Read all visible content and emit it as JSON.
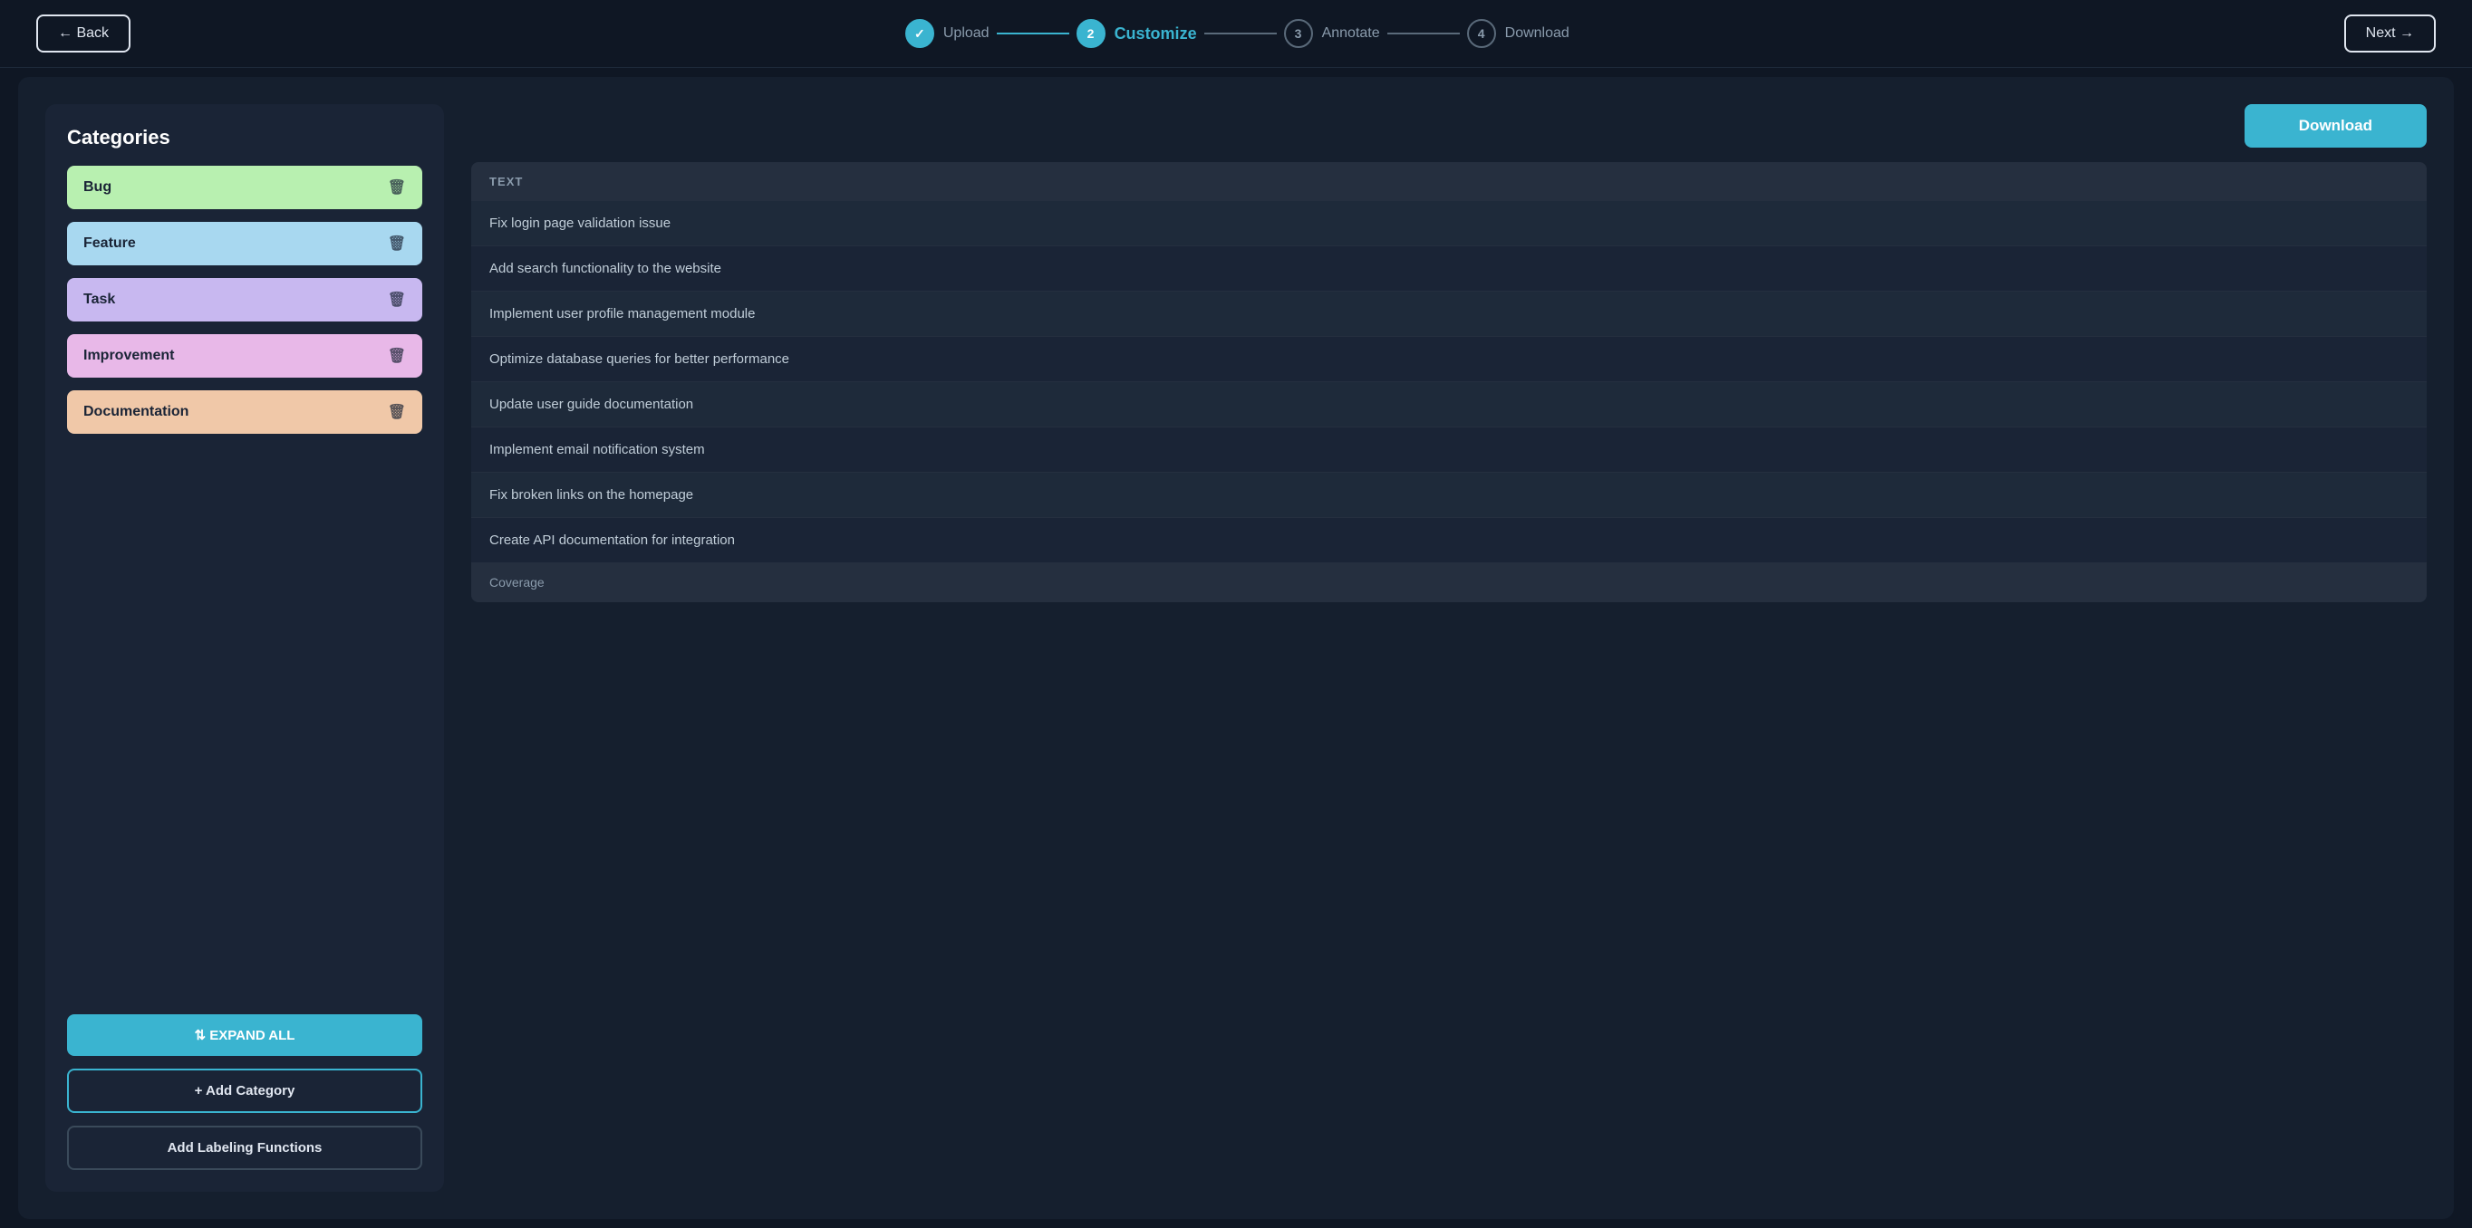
{
  "nav": {
    "back_label": "← Back",
    "next_label": "Next →"
  },
  "stepper": {
    "steps": [
      {
        "id": "upload",
        "number": "✓",
        "label": "Upload",
        "state": "done"
      },
      {
        "id": "customize",
        "number": "2",
        "label": "Customize",
        "state": "active"
      },
      {
        "id": "annotate",
        "number": "3",
        "label": "Annotate",
        "state": "inactive"
      },
      {
        "id": "download",
        "number": "4",
        "label": "Download",
        "state": "inactive"
      }
    ]
  },
  "left_panel": {
    "title": "Categories",
    "categories": [
      {
        "id": "bug",
        "label": "Bug",
        "css_class": "bug"
      },
      {
        "id": "feature",
        "label": "Feature",
        "css_class": "feature"
      },
      {
        "id": "task",
        "label": "Task",
        "css_class": "task"
      },
      {
        "id": "improvement",
        "label": "Improvement",
        "css_class": "improvement"
      },
      {
        "id": "documentation",
        "label": "Documentation",
        "css_class": "documentation"
      }
    ],
    "expand_all_label": "⇅ EXPAND ALL",
    "add_category_label": "+ Add Category",
    "add_labeling_label": "Add Labeling Functions"
  },
  "right_panel": {
    "download_label": "Download",
    "table": {
      "column_header": "TEXT",
      "rows": [
        {
          "text": "Fix login page validation issue"
        },
        {
          "text": "Add search functionality to the website"
        },
        {
          "text": "Implement user profile management module"
        },
        {
          "text": "Optimize database queries for better performance"
        },
        {
          "text": "Update user guide documentation"
        },
        {
          "text": "Implement email notification system"
        },
        {
          "text": "Fix broken links on the homepage"
        },
        {
          "text": "Create API documentation for integration"
        }
      ],
      "footer_label": "Coverage"
    }
  }
}
